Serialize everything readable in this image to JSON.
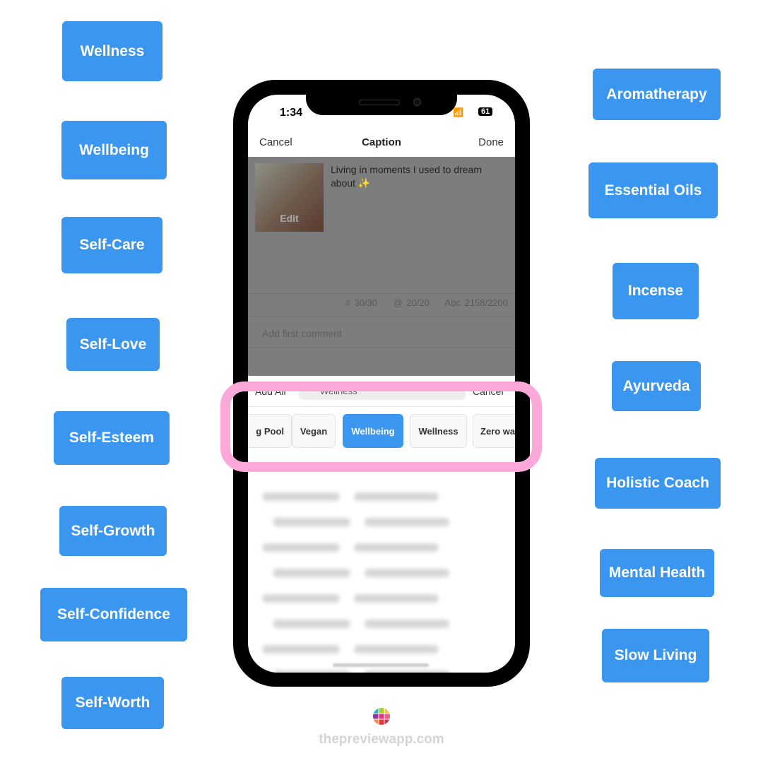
{
  "left_tags": [
    "Wellness",
    "Wellbeing",
    "Self-Care",
    "Self-Love",
    "Self-Esteem",
    "Self-Growth",
    "Self-Confidence",
    "Self-Worth"
  ],
  "right_tags": [
    "Aromatherapy",
    "Essential Oils",
    "Incense",
    "Ayurveda",
    "Holistic Coach",
    "Mental Health",
    "Slow Living"
  ],
  "colors": {
    "tag": "#3a96ee",
    "highlight": "#fca8d9"
  },
  "phone": {
    "status": {
      "time": "1:34",
      "battery": "61"
    },
    "nav": {
      "cancel": "Cancel",
      "title": "Caption",
      "done": "Done"
    },
    "caption": {
      "text": "Living in moments I used to dream about ✨",
      "edit": "Edit"
    },
    "counters": {
      "hashtags": "# 30/30",
      "mentions": "@ 20/20",
      "chars": "Abc 2158/2200"
    },
    "comment_placeholder": "Add first comment",
    "hashtag_bar": {
      "add_all": "Add All",
      "search_value": "Wellness",
      "cancel": "Cancel"
    },
    "chips": [
      {
        "label": "g Pool",
        "active": false
      },
      {
        "label": "Vegan",
        "active": false
      },
      {
        "label": "Wellbeing",
        "active": true
      },
      {
        "label": "Wellness",
        "active": false
      },
      {
        "label": "Zero wa",
        "active": false
      }
    ]
  },
  "footer": {
    "site": "thepreviewapp.com"
  }
}
